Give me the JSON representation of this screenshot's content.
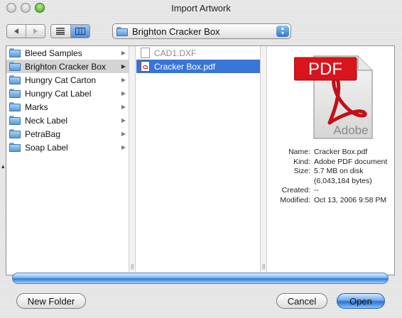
{
  "window": {
    "title": "Import Artwork"
  },
  "toolbar": {
    "back_icon": "back-arrow-icon",
    "forward_icon": "forward-arrow-icon",
    "list_view_icon": "list-view-icon",
    "column_view_icon": "column-view-icon",
    "location": "Brighton Cracker Box"
  },
  "column1": {
    "items": [
      {
        "label": "Bleed Samples"
      },
      {
        "label": "Brighton Cracker Box"
      },
      {
        "label": "Hungry Cat Carton"
      },
      {
        "label": "Hungry Cat Label"
      },
      {
        "label": "Marks"
      },
      {
        "label": "Neck Label"
      },
      {
        "label": "PetraBag"
      },
      {
        "label": "Soap Label"
      }
    ],
    "selected_index": 1
  },
  "column2": {
    "items": [
      {
        "label": "CAD1.DXF",
        "enabled": false
      },
      {
        "label": "Cracker Box.pdf",
        "enabled": true
      }
    ],
    "selected_index": 1
  },
  "preview": {
    "badge": "PDF",
    "brand": "Adobe",
    "labels": {
      "name": "Name:",
      "kind": "Kind:",
      "size": "Size:",
      "created": "Created:",
      "modified": "Modified:"
    },
    "values": {
      "name": "Cracker Box.pdf",
      "kind": "Adobe PDF document",
      "size": "5.7 MB on disk (6,043,184 bytes)",
      "created": "--",
      "modified": "Oct 13, 2006 9:58 PM"
    }
  },
  "buttons": {
    "new_folder": "New Folder",
    "cancel": "Cancel",
    "open": "Open"
  },
  "colors": {
    "selection_blue": "#3875d7",
    "selection_grey": "#d4d4d4",
    "pdf_red": "#d8141c"
  }
}
